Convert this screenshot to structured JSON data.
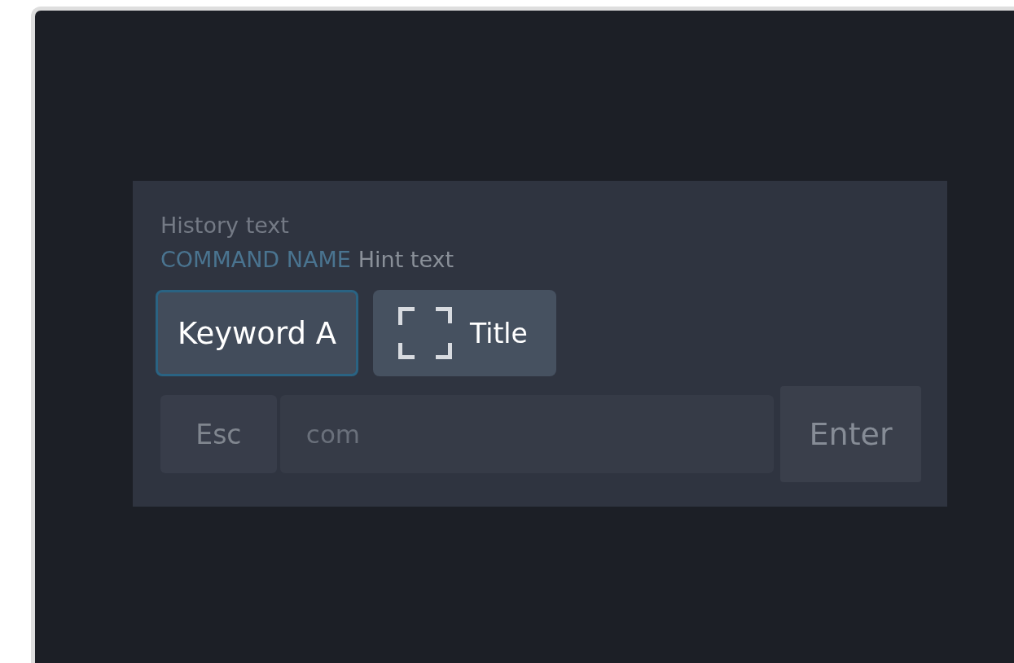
{
  "history": "History text",
  "command": {
    "name": "COMMAND NAME",
    "hint": "Hint text"
  },
  "options": [
    {
      "kind": "keyword",
      "label": "Keyword A",
      "selected": true
    },
    {
      "kind": "focus",
      "label": "Title",
      "selected": false
    }
  ],
  "input": {
    "cancel": "Esc",
    "placeholder": "com",
    "submit": "Enter"
  }
}
